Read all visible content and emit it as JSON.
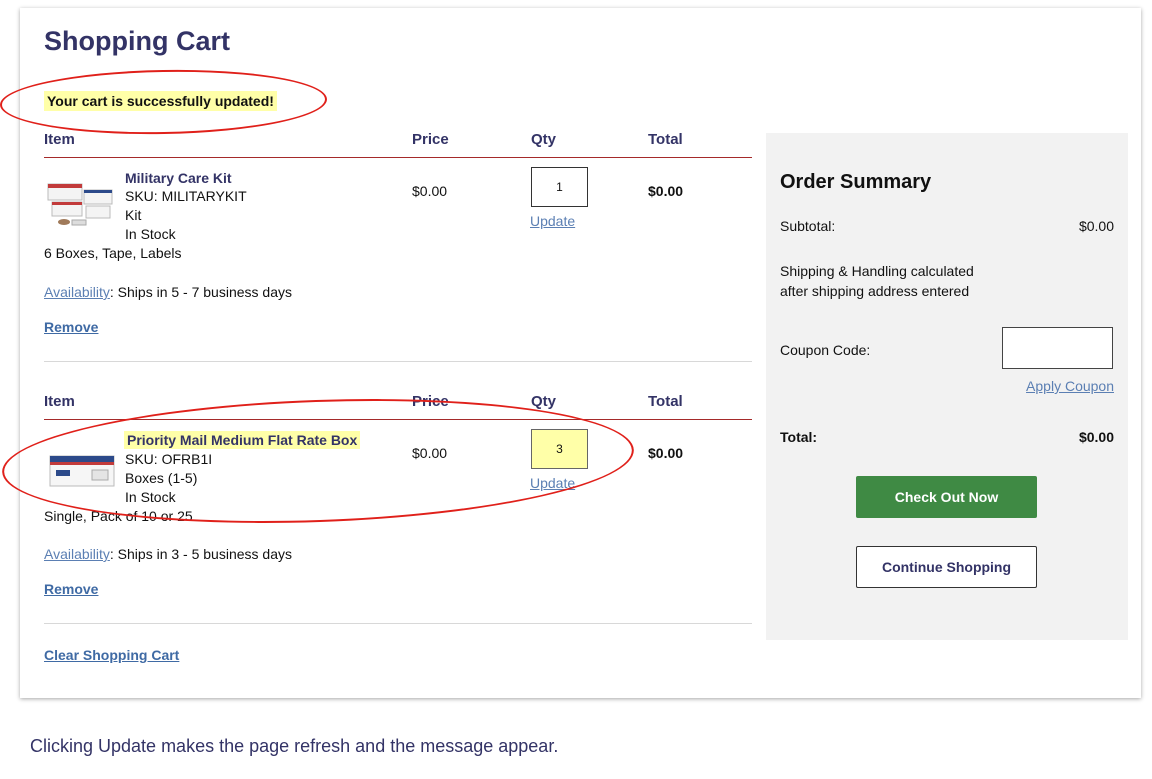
{
  "page_title": "Shopping Cart",
  "message": "Your cart is successfully updated!",
  "columns": {
    "item": "Item",
    "price": "Price",
    "qty": "Qty",
    "total": "Total"
  },
  "items": [
    {
      "name": "Military Care Kit",
      "sku": "SKU: MILITARYKIT",
      "type": "Kit",
      "stock": "In Stock",
      "description": "6 Boxes, Tape, Labels",
      "price": "$0.00",
      "qty": "1",
      "total": "$0.00",
      "update_label": "Update",
      "availability_link": "Availability",
      "availability_text": ": Ships in 5 - 7 business days",
      "remove_label": "Remove",
      "thumb_icon": "boxes-kit-image"
    },
    {
      "name": "Priority Mail Medium Flat Rate Box",
      "sku": "SKU: OFRB1I",
      "type": "Boxes (1-5)",
      "stock": "In Stock",
      "description": "Single, Pack of 10 or 25",
      "price": "$0.00",
      "qty": "3",
      "total": "$0.00",
      "update_label": "Update",
      "availability_link": "Availability",
      "availability_text": ": Ships in 3 - 5 business days",
      "remove_label": "Remove",
      "thumb_icon": "flat-rate-box-image"
    }
  ],
  "clear_cart": "Clear Shopping Cart",
  "summary": {
    "title": "Order Summary",
    "subtotal_label": "Subtotal:",
    "subtotal_value": "$0.00",
    "shipping_line1": "Shipping & Handling calculated",
    "shipping_line2": "after shipping address entered",
    "coupon_label": "Coupon Code:",
    "coupon_value": "",
    "apply_coupon": "Apply Coupon",
    "total_label": "Total:",
    "total_value": "$0.00",
    "checkout_button": "Check Out Now",
    "continue_button": "Continue Shopping"
  },
  "caption": "Clicking Update makes the page refresh and the message appear.",
  "colors": {
    "accent_navy": "#333366",
    "highlight": "#ffffa8",
    "checkout_green": "#3f8a44",
    "annotation_red": "#e0201a",
    "link_blue": "#5b7fb3"
  }
}
